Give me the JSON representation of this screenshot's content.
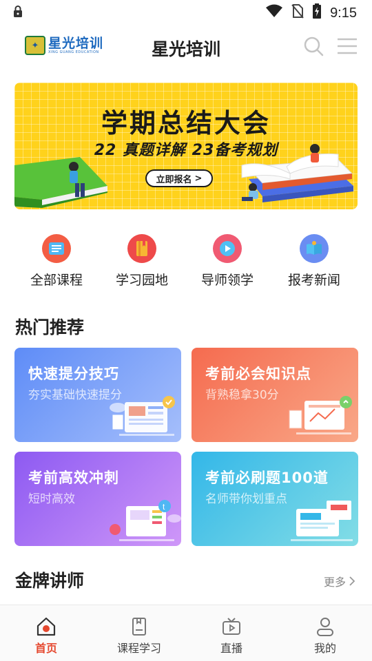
{
  "status_bar": {
    "time": "9:15"
  },
  "header": {
    "logo_name": "星光培训",
    "logo_sub": "XING GUANG EDUCATION",
    "title": "星光培训"
  },
  "banner": {
    "title": "学期总结大会",
    "subtitle": "22 真题详解  23备考规划",
    "button_label": "立即报名",
    "button_arrow": ">"
  },
  "quick_nav": [
    {
      "label": "全部课程",
      "icon": "course-list-icon",
      "color": "#f0543c"
    },
    {
      "label": "学习园地",
      "icon": "book-icon",
      "color": "#ee4a4a"
    },
    {
      "label": "导师领学",
      "icon": "play-icon",
      "color": "#f05a72"
    },
    {
      "label": "报考新闻",
      "icon": "open-book-icon",
      "color": "#5b86f0"
    }
  ],
  "hot_section": {
    "title": "热门推荐"
  },
  "cards": [
    {
      "title": "快速提分技巧",
      "subtitle": "夯实基础快速提分",
      "from": "#5e8cf7",
      "to": "#9fb9fb"
    },
    {
      "title": "考前必会知识点",
      "subtitle": "背熟稳拿30分",
      "from": "#f56b4f",
      "to": "#f8a180"
    },
    {
      "title": "考前高效冲刺",
      "subtitle": "短时高效",
      "from": "#8d5af2",
      "to": "#c58ef8"
    },
    {
      "title": "考前必刷题100道",
      "subtitle": "名师带你划重点",
      "from": "#33b7e8",
      "to": "#79dbe6"
    }
  ],
  "teacher_section": {
    "title": "金牌讲师",
    "more_label": "更多"
  },
  "bottom_nav": [
    {
      "label": "首页",
      "icon": "home-icon",
      "active": true
    },
    {
      "label": "课程学习",
      "icon": "notebook-icon",
      "active": false
    },
    {
      "label": "直播",
      "icon": "tv-icon",
      "active": false
    },
    {
      "label": "我的",
      "icon": "user-icon",
      "active": false
    }
  ],
  "colors": {
    "accent": "#e5482f",
    "banner_bg": "#ffd21c"
  }
}
